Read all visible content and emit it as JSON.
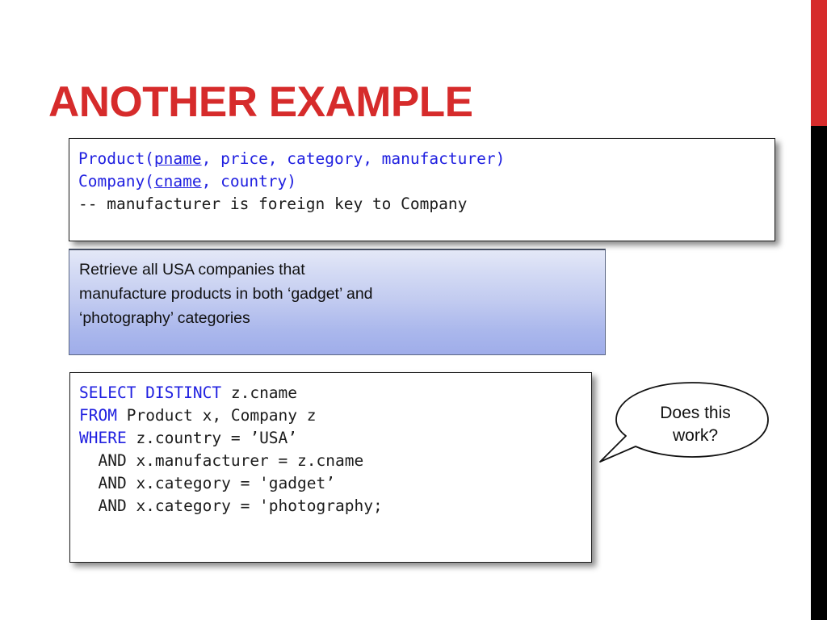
{
  "slide": {
    "title": "ANOTHER EXAMPLE",
    "title_color": "#D62B2B",
    "background": "#FFFFFF"
  },
  "decor": {
    "edge_bar_red_color": "#D62B2B",
    "edge_bar_black_color": "#000000"
  },
  "schema_box": {
    "name": "schema-declaration",
    "lines": [
      {
        "segments": [
          {
            "text": "Product(",
            "style": "keyword"
          },
          {
            "text": "pname",
            "style": "keyword-underline"
          },
          {
            "text": ", price, category, manufacturer)",
            "style": "keyword"
          }
        ]
      },
      {
        "segments": [
          {
            "text": "Company(",
            "style": "keyword"
          },
          {
            "text": "cname",
            "style": "keyword-underline"
          },
          {
            "text": ", country)",
            "style": "keyword"
          }
        ]
      },
      {
        "segments": [
          {
            "text": "-- manufacturer is foreign key to Company",
            "style": "plain"
          }
        ]
      }
    ],
    "plain_text": "Product(pname, price, category, manufacturer)\nCompany(cname, country)\n-- manufacturer is foreign key to Company"
  },
  "description_box": {
    "name": "question-prompt",
    "text": "Retrieve all USA companies that\nmanufacture products in both ‘gadget’ and\n‘photography’ categories",
    "gradient_top": "#E4E8F7",
    "gradient_bottom": "#9FADEA",
    "border_color": "#5B6784"
  },
  "sql_box": {
    "name": "sql-query",
    "lines": [
      {
        "segments": [
          {
            "text": "SELECT DISTINCT",
            "style": "keyword"
          },
          {
            "text": " z.cname",
            "style": "plain"
          }
        ]
      },
      {
        "segments": [
          {
            "text": "FROM",
            "style": "keyword"
          },
          {
            "text": " Product x, Company z",
            "style": "plain"
          }
        ]
      },
      {
        "segments": [
          {
            "text": "WHERE",
            "style": "keyword"
          },
          {
            "text": " z.country = ’USA’",
            "style": "plain"
          }
        ]
      },
      {
        "segments": [
          {
            "text": "  AND x.manufacturer = z.cname",
            "style": "plain"
          }
        ]
      },
      {
        "segments": [
          {
            "text": "  AND x.category = 'gadget’",
            "style": "plain"
          }
        ]
      },
      {
        "segments": [
          {
            "text": "  AND x.category = 'photography;",
            "style": "plain"
          }
        ]
      }
    ],
    "plain_text": "SELECT DISTINCT z.cname\nFROM Product x, Company z\nWHERE z.country = ’USA’\n  AND x.manufacturer = z.cname\n  AND x.category = 'gadget’\n  AND x.category = 'photography;"
  },
  "speech_bubble": {
    "name": "does-this-work-callout",
    "text": "Does this\nwork?"
  }
}
